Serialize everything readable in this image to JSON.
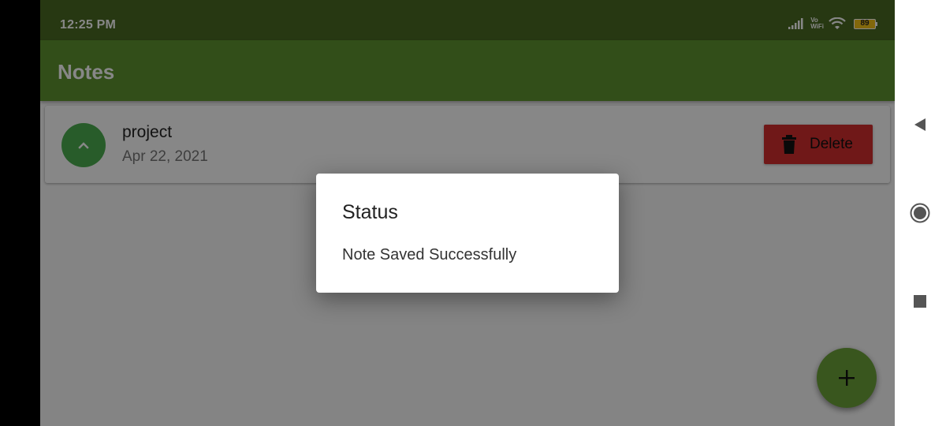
{
  "status_bar": {
    "time": "12:25 PM",
    "network_label_top": "Vo",
    "network_label_bottom": "WiFi",
    "battery": "89"
  },
  "app_bar": {
    "title": "Notes"
  },
  "notes": [
    {
      "title": "project",
      "date": "Apr 22, 2021",
      "delete_label": "Delete"
    }
  ],
  "dialog": {
    "title": "Status",
    "message": "Note Saved Successfully"
  },
  "icons": {
    "expand": "chevron-up-icon",
    "trash": "trash-icon",
    "fab": "plus-icon",
    "back": "back-triangle-icon",
    "home": "home-circle-icon",
    "recents": "recents-square-icon"
  },
  "colors": {
    "status_bar": "#4a6a22",
    "app_bar": "#5f9430",
    "expand_button": "#4caf50",
    "delete_button": "#d32f2f",
    "fab": "#6da23a"
  }
}
